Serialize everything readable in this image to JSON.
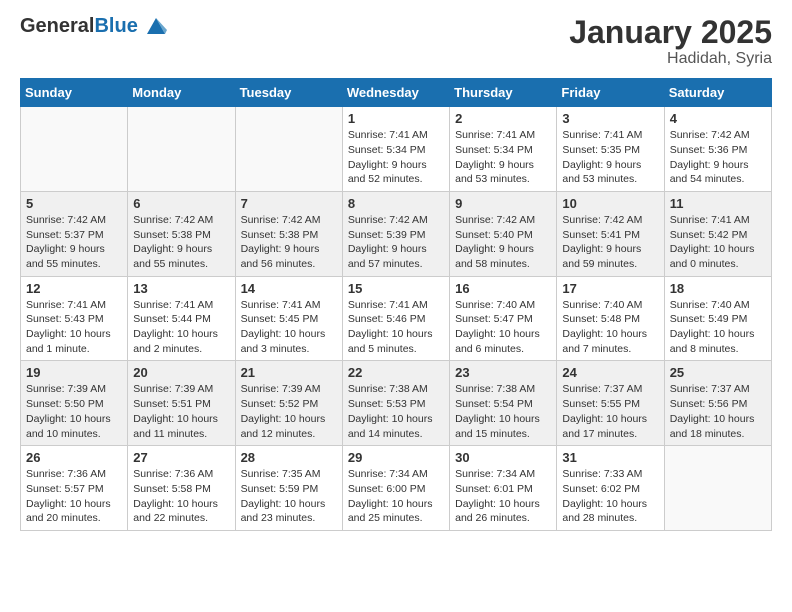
{
  "header": {
    "logo_general": "General",
    "logo_blue": "Blue",
    "month_title": "January 2025",
    "location": "Hadidah, Syria"
  },
  "weekdays": [
    "Sunday",
    "Monday",
    "Tuesday",
    "Wednesday",
    "Thursday",
    "Friday",
    "Saturday"
  ],
  "weeks": [
    {
      "alt": false,
      "days": [
        {
          "num": "",
          "info": ""
        },
        {
          "num": "",
          "info": ""
        },
        {
          "num": "",
          "info": ""
        },
        {
          "num": "1",
          "info": "Sunrise: 7:41 AM\nSunset: 5:34 PM\nDaylight: 9 hours\nand 52 minutes."
        },
        {
          "num": "2",
          "info": "Sunrise: 7:41 AM\nSunset: 5:34 PM\nDaylight: 9 hours\nand 53 minutes."
        },
        {
          "num": "3",
          "info": "Sunrise: 7:41 AM\nSunset: 5:35 PM\nDaylight: 9 hours\nand 53 minutes."
        },
        {
          "num": "4",
          "info": "Sunrise: 7:42 AM\nSunset: 5:36 PM\nDaylight: 9 hours\nand 54 minutes."
        }
      ]
    },
    {
      "alt": true,
      "days": [
        {
          "num": "5",
          "info": "Sunrise: 7:42 AM\nSunset: 5:37 PM\nDaylight: 9 hours\nand 55 minutes."
        },
        {
          "num": "6",
          "info": "Sunrise: 7:42 AM\nSunset: 5:38 PM\nDaylight: 9 hours\nand 55 minutes."
        },
        {
          "num": "7",
          "info": "Sunrise: 7:42 AM\nSunset: 5:38 PM\nDaylight: 9 hours\nand 56 minutes."
        },
        {
          "num": "8",
          "info": "Sunrise: 7:42 AM\nSunset: 5:39 PM\nDaylight: 9 hours\nand 57 minutes."
        },
        {
          "num": "9",
          "info": "Sunrise: 7:42 AM\nSunset: 5:40 PM\nDaylight: 9 hours\nand 58 minutes."
        },
        {
          "num": "10",
          "info": "Sunrise: 7:42 AM\nSunset: 5:41 PM\nDaylight: 9 hours\nand 59 minutes."
        },
        {
          "num": "11",
          "info": "Sunrise: 7:41 AM\nSunset: 5:42 PM\nDaylight: 10 hours\nand 0 minutes."
        }
      ]
    },
    {
      "alt": false,
      "days": [
        {
          "num": "12",
          "info": "Sunrise: 7:41 AM\nSunset: 5:43 PM\nDaylight: 10 hours\nand 1 minute."
        },
        {
          "num": "13",
          "info": "Sunrise: 7:41 AM\nSunset: 5:44 PM\nDaylight: 10 hours\nand 2 minutes."
        },
        {
          "num": "14",
          "info": "Sunrise: 7:41 AM\nSunset: 5:45 PM\nDaylight: 10 hours\nand 3 minutes."
        },
        {
          "num": "15",
          "info": "Sunrise: 7:41 AM\nSunset: 5:46 PM\nDaylight: 10 hours\nand 5 minutes."
        },
        {
          "num": "16",
          "info": "Sunrise: 7:40 AM\nSunset: 5:47 PM\nDaylight: 10 hours\nand 6 minutes."
        },
        {
          "num": "17",
          "info": "Sunrise: 7:40 AM\nSunset: 5:48 PM\nDaylight: 10 hours\nand 7 minutes."
        },
        {
          "num": "18",
          "info": "Sunrise: 7:40 AM\nSunset: 5:49 PM\nDaylight: 10 hours\nand 8 minutes."
        }
      ]
    },
    {
      "alt": true,
      "days": [
        {
          "num": "19",
          "info": "Sunrise: 7:39 AM\nSunset: 5:50 PM\nDaylight: 10 hours\nand 10 minutes."
        },
        {
          "num": "20",
          "info": "Sunrise: 7:39 AM\nSunset: 5:51 PM\nDaylight: 10 hours\nand 11 minutes."
        },
        {
          "num": "21",
          "info": "Sunrise: 7:39 AM\nSunset: 5:52 PM\nDaylight: 10 hours\nand 12 minutes."
        },
        {
          "num": "22",
          "info": "Sunrise: 7:38 AM\nSunset: 5:53 PM\nDaylight: 10 hours\nand 14 minutes."
        },
        {
          "num": "23",
          "info": "Sunrise: 7:38 AM\nSunset: 5:54 PM\nDaylight: 10 hours\nand 15 minutes."
        },
        {
          "num": "24",
          "info": "Sunrise: 7:37 AM\nSunset: 5:55 PM\nDaylight: 10 hours\nand 17 minutes."
        },
        {
          "num": "25",
          "info": "Sunrise: 7:37 AM\nSunset: 5:56 PM\nDaylight: 10 hours\nand 18 minutes."
        }
      ]
    },
    {
      "alt": false,
      "days": [
        {
          "num": "26",
          "info": "Sunrise: 7:36 AM\nSunset: 5:57 PM\nDaylight: 10 hours\nand 20 minutes."
        },
        {
          "num": "27",
          "info": "Sunrise: 7:36 AM\nSunset: 5:58 PM\nDaylight: 10 hours\nand 22 minutes."
        },
        {
          "num": "28",
          "info": "Sunrise: 7:35 AM\nSunset: 5:59 PM\nDaylight: 10 hours\nand 23 minutes."
        },
        {
          "num": "29",
          "info": "Sunrise: 7:34 AM\nSunset: 6:00 PM\nDaylight: 10 hours\nand 25 minutes."
        },
        {
          "num": "30",
          "info": "Sunrise: 7:34 AM\nSunset: 6:01 PM\nDaylight: 10 hours\nand 26 minutes."
        },
        {
          "num": "31",
          "info": "Sunrise: 7:33 AM\nSunset: 6:02 PM\nDaylight: 10 hours\nand 28 minutes."
        },
        {
          "num": "",
          "info": ""
        }
      ]
    }
  ]
}
